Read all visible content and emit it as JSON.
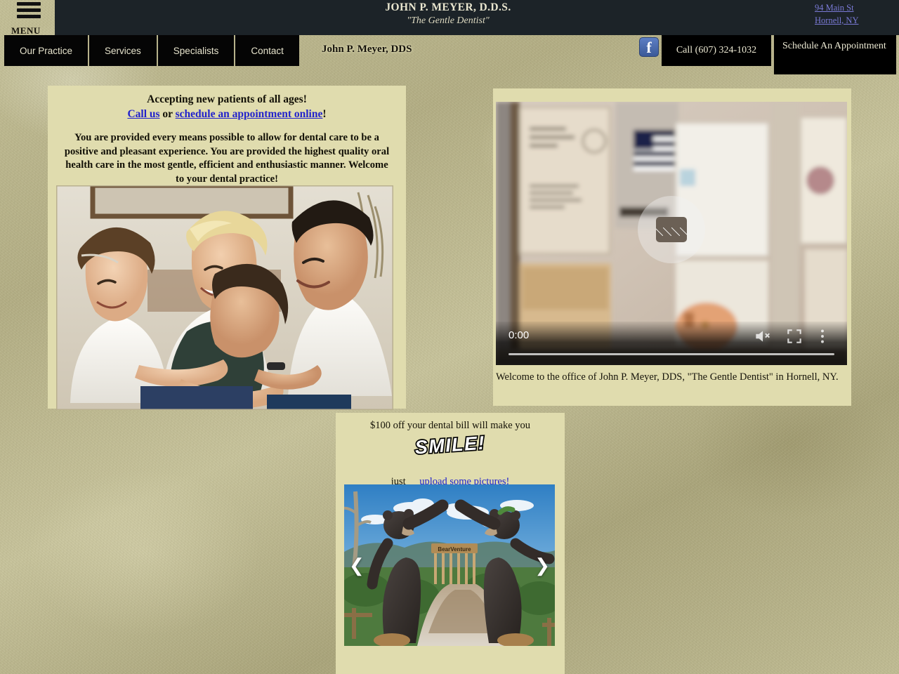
{
  "header": {
    "menu_label": "MENU",
    "menu_icon": "hamburger-icon",
    "title": "JOHN P. MEYER, D.D.S.",
    "tagline": "\"The Gentle Dentist\"",
    "address_line1": "94 Main St",
    "address_line2": "Hornell, NY",
    "doctor_name": "John P. Meyer, DDS",
    "facebook_icon": "facebook-icon",
    "facebook_glyph": "f",
    "call_label": "Call (607) 324-1032",
    "schedule_label": "Schedule An Appointment"
  },
  "nav": {
    "items": [
      {
        "label": "Our Practice"
      },
      {
        "label": "Services"
      },
      {
        "label": "Specialists"
      },
      {
        "label": "Contact"
      }
    ]
  },
  "left_panel": {
    "headline": "Accepting new patients of all ages!",
    "call_link": "Call us",
    "or_text": " or ",
    "schedule_link": "schedule an appointment online",
    "exclaim": "!",
    "body": "You are provided every means possible to allow for dental care to be a positive and pleasant experience. You are provided the highest quality oral health care in the most gentle, efficient and enthusiastic manner. Welcome to your dental practice!",
    "photo_alt": "family-photo"
  },
  "video": {
    "current_time": "0:00",
    "placeholder_icon": "broken-media-icon",
    "mute_icon": "muted-volume-icon",
    "fullscreen_icon": "fullscreen-icon",
    "menu_icon": "kebab-menu-icon",
    "caption": "Welcome to the office of John P. Meyer, DDS, \"The Gentle Dentist\" in Hornell, NY.",
    "poster_alt": "office-wall-with-flag"
  },
  "bottom_panel": {
    "promo_text": "$100 off your dental bill will make you",
    "smile_graphic": "SMILE!",
    "just_label": "just",
    "upload_link": "upload some pictures!",
    "carousel": {
      "prev_icon": "chevron-left-icon",
      "next_icon": "chevron-right-icon",
      "image_alt": "bear-statues-archway",
      "sign_text": "BearVenture"
    }
  },
  "colors": {
    "header_bar": "#1c2328",
    "nav_button": "#050505",
    "panel": "#e0dcae",
    "page_background": "#bcb78e",
    "link": "#2222cc",
    "header_link": "#7a7ad6",
    "facebook_blue": "#3b5998"
  }
}
